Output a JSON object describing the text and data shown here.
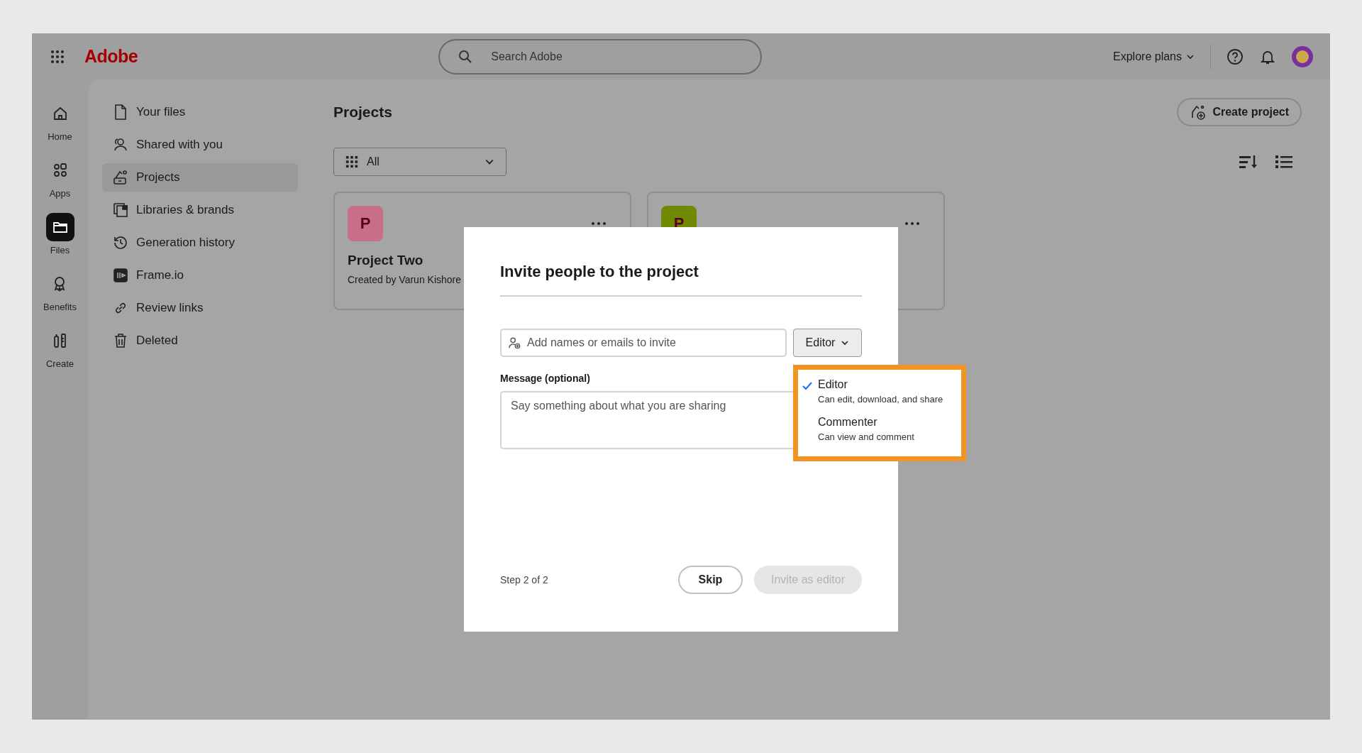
{
  "header": {
    "logo": "Adobe",
    "search": {
      "placeholder": "Search Adobe"
    },
    "explore": "Explore plans"
  },
  "rail": [
    {
      "label": "Home",
      "selected": false
    },
    {
      "label": "Apps",
      "selected": false
    },
    {
      "label": "Files",
      "selected": true
    },
    {
      "label": "Benefits",
      "selected": false
    },
    {
      "label": "Create",
      "selected": false
    }
  ],
  "nav": [
    {
      "label": "Your files",
      "selected": false
    },
    {
      "label": "Shared with you",
      "selected": false
    },
    {
      "label": "Projects",
      "selected": true
    },
    {
      "label": "Libraries & brands",
      "selected": false
    },
    {
      "label": "Generation history",
      "selected": false
    },
    {
      "label": "Frame.io",
      "selected": false
    },
    {
      "label": "Review links",
      "selected": false
    },
    {
      "label": "Deleted",
      "selected": false
    }
  ],
  "page": {
    "title": "Projects",
    "create_button": "Create project",
    "filter": "All",
    "cards": [
      {
        "initial": "P",
        "color": "#c66f86",
        "title": "Project Two",
        "subtitle": "Created by Varun Kishore"
      },
      {
        "initial": "P",
        "color": "#6f8a00"
      }
    ]
  },
  "dialog": {
    "title": "Invite people to the project",
    "invite": {
      "placeholder": "Add names or emails to invite"
    },
    "role": "Editor",
    "message_label": "Message (optional)",
    "message": {
      "placeholder": "Say something about what you are sharing"
    },
    "step": "Step 2 of 2",
    "skip": "Skip",
    "submit": {
      "label": "Invite as editor",
      "disabled": true
    },
    "role_menu": [
      {
        "label": "Editor",
        "description": "Can edit, download, and share",
        "selected": true
      },
      {
        "label": "Commenter",
        "description": "Can view and comment",
        "selected": false
      }
    ]
  }
}
